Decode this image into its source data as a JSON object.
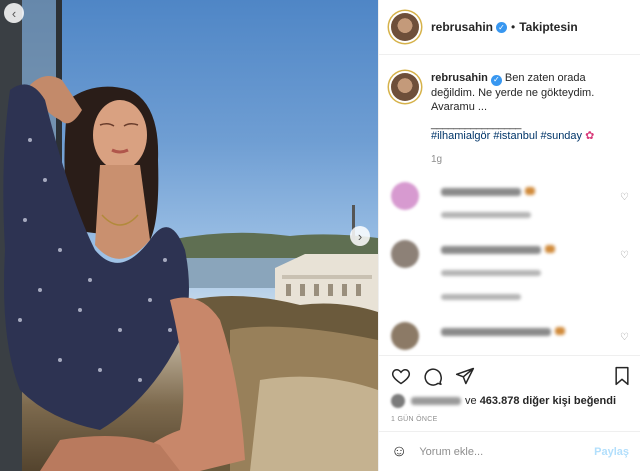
{
  "post": {
    "username": "rebrusahin",
    "follow_state": "Takiptesin",
    "dot": "•",
    "caption_line1": "Ben zaten orada",
    "caption_line2": "değildim. Ne yerde ne gökteydim.",
    "caption_line3": "Avaramu ...",
    "divider": "________________",
    "hashtags": "#ilhamialgör #istanbul #sunday",
    "caption_time": "1g",
    "likes_prefix": "ve",
    "likes_count": "463.878",
    "likes_suffix": "diğer kişi beğendi",
    "post_date": "1 GÜN ÖNCE",
    "comment_placeholder": "Yorum ekle...",
    "post_button": "Paylaş"
  },
  "icons": {
    "verified": "verified-badge",
    "flower": "✿",
    "emoji": "☺",
    "prev": "‹",
    "next": "›"
  },
  "colors": {
    "link": "#003569",
    "verified": "#3897f0",
    "post_disabled": "#b2dffc"
  }
}
